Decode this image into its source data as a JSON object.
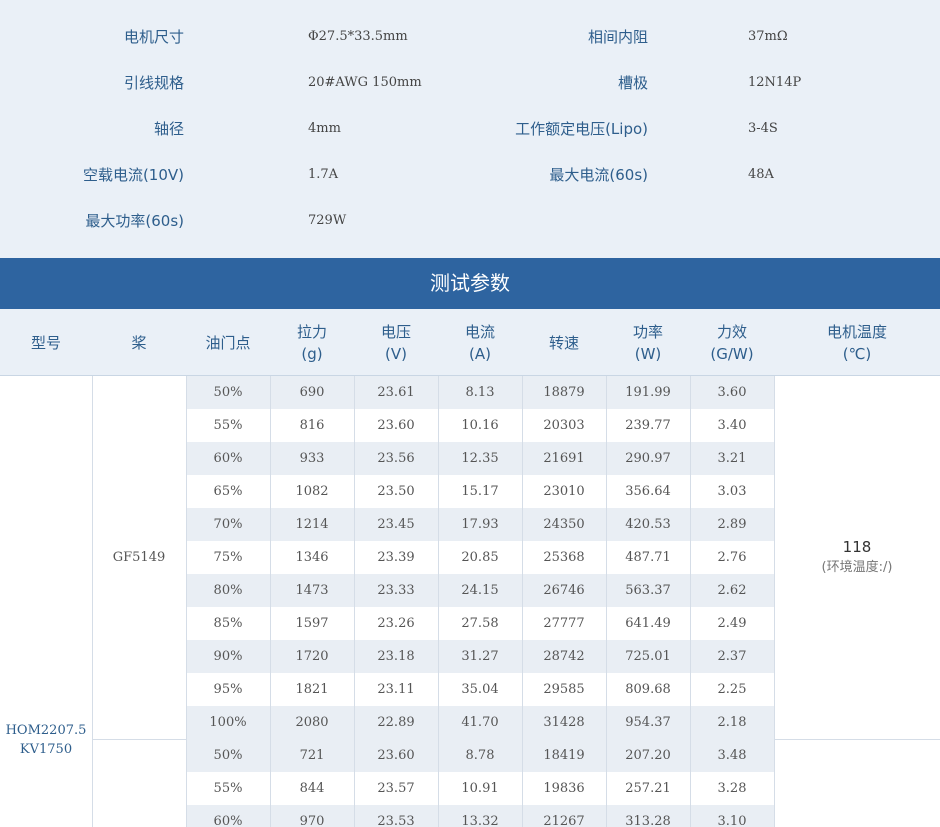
{
  "specs": [
    {
      "left_label": "电机尺寸",
      "left_value": "Φ27.5*33.5mm",
      "right_label": "相间内阻",
      "right_value": "37mΩ"
    },
    {
      "left_label": "引线规格",
      "left_value": "20#AWG 150mm",
      "right_label": "槽极",
      "right_value": "12N14P"
    },
    {
      "left_label": "轴径",
      "left_value": "4mm",
      "right_label": "工作额定电压(Lipo)",
      "right_value": "3-4S"
    },
    {
      "left_label": "空载电流(10V)",
      "left_value": "1.7A",
      "right_label": "最大电流(60s)",
      "right_value": "48A"
    },
    {
      "left_label": "最大功率(60s)",
      "left_value": "729W",
      "right_label": "",
      "right_value": ""
    }
  ],
  "section_title": "测试参数",
  "table": {
    "headers": [
      {
        "line1": "型号",
        "line2": ""
      },
      {
        "line1": "桨",
        "line2": ""
      },
      {
        "line1": "油门点",
        "line2": ""
      },
      {
        "line1": "拉力",
        "line2": "(g)"
      },
      {
        "line1": "电压",
        "line2": "(V)"
      },
      {
        "line1": "电流",
        "line2": "(A)"
      },
      {
        "line1": "转速",
        "line2": ""
      },
      {
        "line1": "功率",
        "line2": "(W)"
      },
      {
        "line1": "力效",
        "line2": "(G/W)"
      },
      {
        "line1": "电机温度",
        "line2": "(℃)"
      }
    ],
    "model_line1": "HOM2207.5",
    "model_line2": "KV1750",
    "groups": [
      {
        "prop": "GF5149",
        "temp_value": "118",
        "temp_note": "(环境温度:/)",
        "rows": [
          [
            "50%",
            "690",
            "23.61",
            "8.13",
            "18879",
            "191.99",
            "3.60"
          ],
          [
            "55%",
            "816",
            "23.60",
            "10.16",
            "20303",
            "239.77",
            "3.40"
          ],
          [
            "60%",
            "933",
            "23.56",
            "12.35",
            "21691",
            "290.97",
            "3.21"
          ],
          [
            "65%",
            "1082",
            "23.50",
            "15.17",
            "23010",
            "356.64",
            "3.03"
          ],
          [
            "70%",
            "1214",
            "23.45",
            "17.93",
            "24350",
            "420.53",
            "2.89"
          ],
          [
            "75%",
            "1346",
            "23.39",
            "20.85",
            "25368",
            "487.71",
            "2.76"
          ],
          [
            "80%",
            "1473",
            "23.33",
            "24.15",
            "26746",
            "563.37",
            "2.62"
          ],
          [
            "85%",
            "1597",
            "23.26",
            "27.58",
            "27777",
            "641.49",
            "2.49"
          ],
          [
            "90%",
            "1720",
            "23.18",
            "31.27",
            "28742",
            "725.01",
            "2.37"
          ],
          [
            "95%",
            "1821",
            "23.11",
            "35.04",
            "29585",
            "809.68",
            "2.25"
          ],
          [
            "100%",
            "2080",
            "22.89",
            "41.70",
            "31428",
            "954.37",
            "2.18"
          ]
        ]
      },
      {
        "prop": "",
        "temp_value": "",
        "temp_note": "",
        "rows": [
          [
            "50%",
            "721",
            "23.60",
            "8.78",
            "18419",
            "207.20",
            "3.48"
          ],
          [
            "55%",
            "844",
            "23.57",
            "10.91",
            "19836",
            "257.21",
            "3.28"
          ],
          [
            "60%",
            "970",
            "23.53",
            "13.32",
            "21267",
            "313.28",
            "3.10"
          ]
        ]
      }
    ]
  }
}
